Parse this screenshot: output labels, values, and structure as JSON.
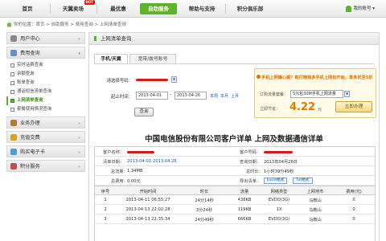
{
  "nav": {
    "items": [
      {
        "label": "首页",
        "active": false
      },
      {
        "label": "天翼卖场",
        "active": false,
        "badge": "HOT"
      },
      {
        "label": "最优惠",
        "active": false
      },
      {
        "label": "自助服务",
        "active": true
      },
      {
        "label": "帮助与支持",
        "active": false
      },
      {
        "label": "积分俱乐部",
        "active": false
      }
    ],
    "user": "我的账号 ▾"
  },
  "breadcrumb": "你的位置：首页 > 自助服务 > 费用查询 > 上网清单查询",
  "sidebar": {
    "sections": [
      {
        "label": "用户中心",
        "items": []
      },
      {
        "label": "费用查询",
        "items": [
          {
            "label": "实时话费查询",
            "active": false
          },
          {
            "label": "余额查询",
            "active": false
          },
          {
            "label": "账单查询",
            "active": false
          },
          {
            "label": "通话短信清单查询",
            "active": false
          },
          {
            "label": "上网清单查询",
            "active": true
          },
          {
            "label": "套餐使用情况查询",
            "active": false
          }
        ]
      },
      {
        "label": "业务办理",
        "items": []
      },
      {
        "label": "充值交费",
        "items": []
      },
      {
        "label": "购买电子卡",
        "items": []
      },
      {
        "label": "积分服务",
        "items": []
      }
    ]
  },
  "main": {
    "title": "上网清单查询",
    "tabs": [
      "手机/天翼",
      "宽带/拨号账号"
    ],
    "form": {
      "phone_label": "请选择号码：",
      "time_label": "起止时间：",
      "date_from": "2013-04-01",
      "date_to": "2013-04-26",
      "date_sep": "-",
      "quick_links": [
        "本周",
        "本月",
        "上月"
      ],
      "query_button": "查询"
    },
    "promo": {
      "text": "手机上网嫌心跳？购打随我多手机上网包开始，享多优至5折",
      "order_label": "订购流量套餐：",
      "order_value": "5元包30M手机上网流量",
      "price_label": "立即节省：",
      "price": "4.22",
      "unit": "元",
      "buy_button": "立即办理"
    }
  },
  "bill": {
    "title": "中国电信股份有限公司客户详单  上网及数据通信详单",
    "info": {
      "customer_label": "客户名称：",
      "customer_no_label": "客户号码：",
      "period_label": "清单日期：",
      "period_value": "2013-04-01-2013.04.26",
      "query_date_label": "查询日期：",
      "query_date_value": "2013年04月26日",
      "total_traffic_label": "总流量：",
      "total_traffic_value": "1.34MB",
      "total_time_label": "总时长：",
      "total_time_value": "1小时39分49秒",
      "total_fee_label": "总费用：",
      "total_fee_value": "0.00元",
      "export_label": "导出清单：",
      "excel_button": "Excel格式",
      "txt_button": "Txt格式"
    },
    "columns": [
      "序号",
      "开始时间",
      "时长",
      "流量",
      "网络类型",
      "上网地市",
      "费用(元)"
    ],
    "rows": [
      [
        "1",
        "2013-04-11 06:55:27",
        "24分14秒",
        "438KB",
        "EVDO(3G)",
        "马鞍山",
        "0"
      ],
      [
        "2",
        "2013-04-13 22:02:28",
        "3分24秒",
        "119KB",
        "1X",
        "马鞍山",
        "0"
      ],
      [
        "3",
        "2013-04-13 22:35:34",
        "24分49秒",
        "666KB",
        "EVDO(3G)",
        "马鞍山",
        "0"
      ]
    ]
  },
  "colors": {
    "accent": "#5fb32a",
    "price": "#e07b00",
    "link": "#1a55b3",
    "redact": "#d21b1b"
  }
}
